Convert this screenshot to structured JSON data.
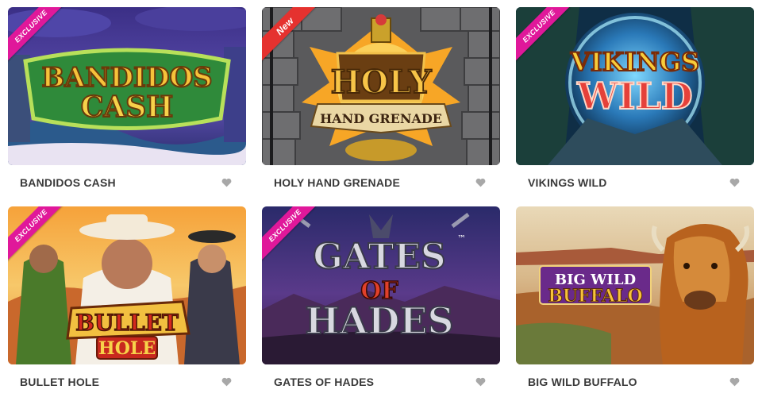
{
  "games": [
    {
      "title": "BANDIDOS CASH",
      "badge": "EXCLUSIVE",
      "logo_lines": [
        "BANDIDOS",
        "CASH"
      ]
    },
    {
      "title": "HOLY HAND GRENADE",
      "badge": "New",
      "logo_lines": [
        "HOLY",
        "HAND GRENADE"
      ]
    },
    {
      "title": "VIKINGS WILD",
      "badge": "EXCLUSIVE",
      "logo_lines": [
        "VIKINGS",
        "WILD"
      ]
    },
    {
      "title": "BULLET HOLE",
      "badge": "EXCLUSIVE",
      "logo_lines": [
        "BULLET",
        "HOLE"
      ]
    },
    {
      "title": "GATES OF HADES",
      "badge": "EXCLUSIVE",
      "logo_lines": [
        "GATES",
        "OF",
        "HADES"
      ],
      "logo_mark": "™"
    },
    {
      "title": "BIG WILD BUFFALO",
      "badge": "",
      "logo_lines": [
        "BIG WILD",
        "BUFFALO"
      ]
    }
  ],
  "colors": {
    "exclusive_badge": "#e0189a",
    "new_badge": "#e5322f",
    "title_text": "#3a3a3a",
    "heart_icon": "#a8a8a8"
  },
  "icons": {
    "favorite": "heart-icon"
  }
}
